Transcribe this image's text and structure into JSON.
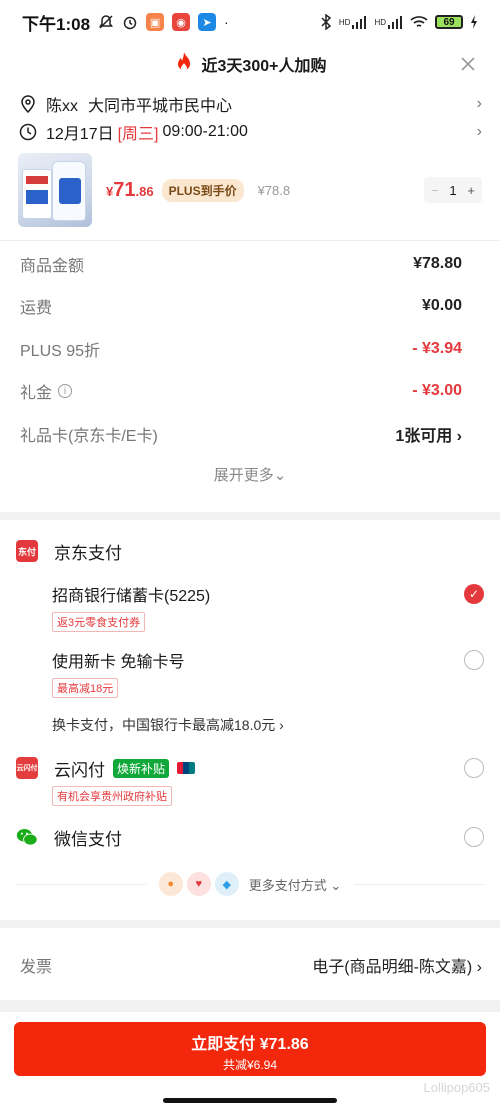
{
  "status_bar": {
    "time": "下午1:08",
    "battery": "69",
    "signal_labels": [
      "HD",
      "HD"
    ]
  },
  "header": {
    "title": "近3天300+人加购"
  },
  "address": {
    "name": "陈xx",
    "detail": "大同市平城市民中心"
  },
  "delivery": {
    "date": "12月17日",
    "weekday": "[周三]",
    "time_range": "09:00-21:00"
  },
  "product": {
    "price_symbol": "¥",
    "price_int": "71",
    "price_dec": ".86",
    "plus_badge": "PLUS到手价",
    "original_price": "¥78.8",
    "quantity": "1",
    "minus": "−",
    "plus": "+"
  },
  "fees": [
    {
      "label": "商品金额",
      "value": "¥78.80",
      "red": false
    },
    {
      "label": "运费",
      "value": "¥0.00",
      "red": false
    },
    {
      "label": "PLUS 95折",
      "value": "- ¥3.94",
      "red": true
    },
    {
      "label": "礼金",
      "value": "- ¥3.00",
      "red": true
    },
    {
      "label": "礼品卡(京东卡/E卡)",
      "value": "1张可用 ›",
      "red": false
    }
  ],
  "expand_more": "展开更多⌄",
  "payment": {
    "jd_pay": {
      "title": "京东支付",
      "logo": "东付"
    },
    "cmb_card": {
      "label": "招商银行储蓄卡(5225)",
      "promo": "返3元零食支付券"
    },
    "new_card": {
      "label": "使用新卡 免输卡号",
      "promo": "最高减18元"
    },
    "switch_card": "换卡支付，中国银行卡最高减18.0元 ›",
    "yunshanfu": {
      "title": "云闪付",
      "badge": "焕新补贴",
      "promo": "有机会享贵州政府补贴",
      "logo": "云闪付"
    },
    "wechat": {
      "title": "微信支付"
    },
    "more": "更多支付方式 ⌄"
  },
  "invoice": {
    "label": "发票",
    "value": "电子(商品明细-陈文嘉) ›"
  },
  "pay_button": {
    "main": "立即支付 ¥71.86",
    "sub": "共减¥6.94"
  },
  "watermark": "Lollipop605",
  "colors": {
    "accent_red": "#e4393c",
    "pay_button": "#f2270c",
    "plus_badge_bg": "#fbe6cf",
    "wechat_green": "#1aad19"
  }
}
